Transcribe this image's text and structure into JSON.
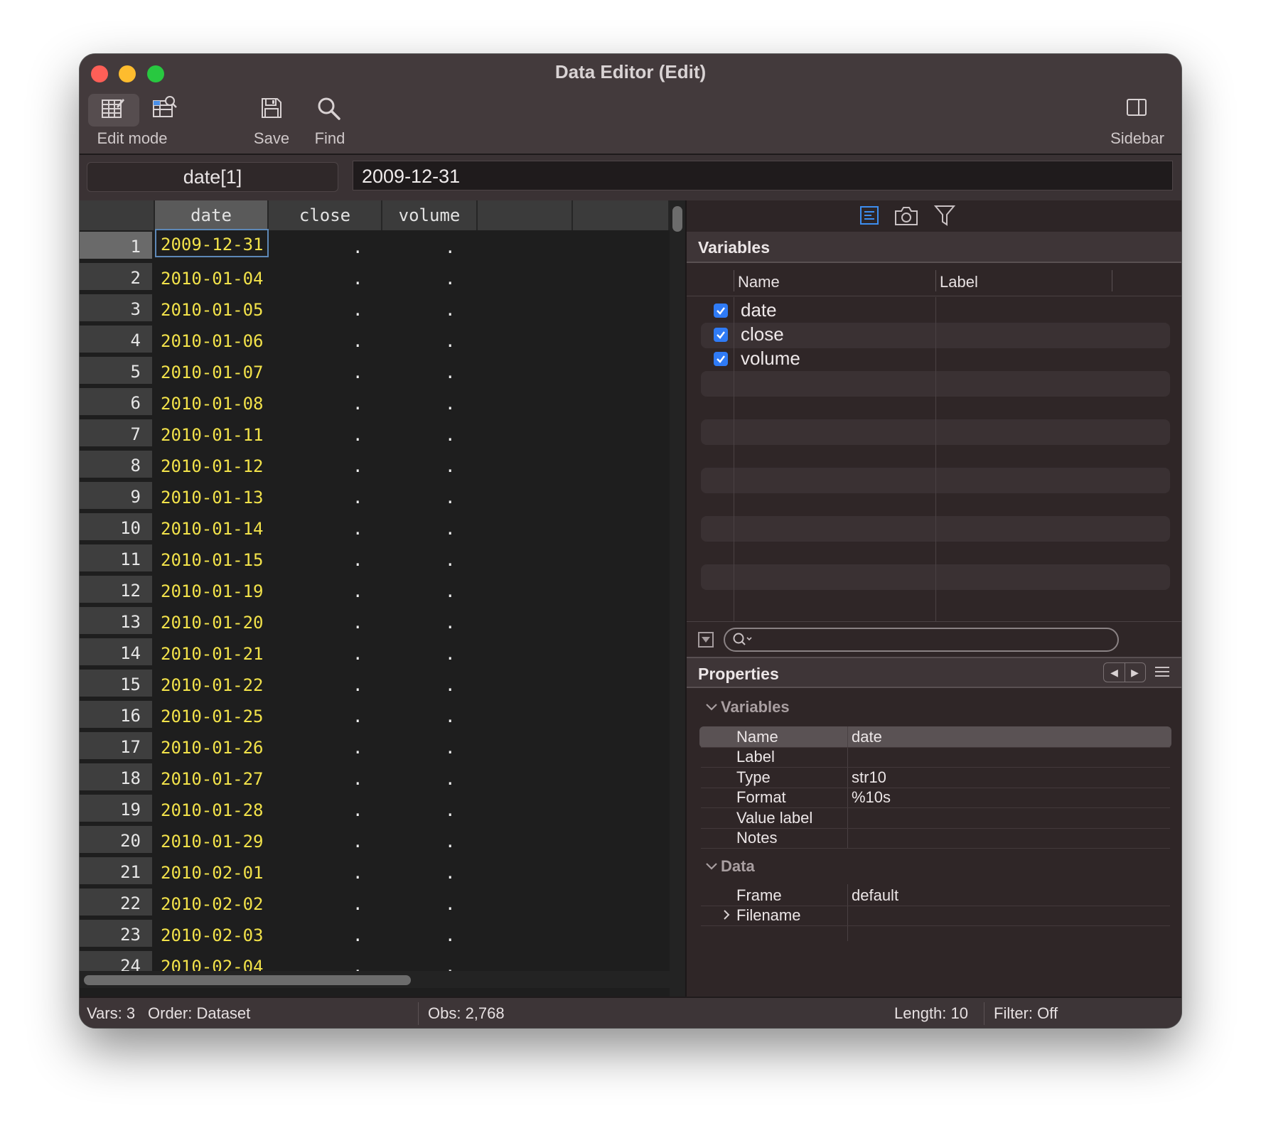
{
  "window": {
    "title": "Data Editor (Edit)"
  },
  "toolbar": {
    "edit_mode_label": "Edit mode",
    "save_label": "Save",
    "find_label": "Find",
    "sidebar_label": "Sidebar",
    "icons": [
      "edit-mode-icon",
      "browse-mode-icon",
      "save-icon",
      "find-icon",
      "sidebar-icon"
    ]
  },
  "cell": {
    "name": "date[1]",
    "value": "2009-12-31"
  },
  "grid": {
    "columns": [
      "date",
      "close",
      "volume"
    ],
    "rows": [
      {
        "n": "1",
        "date": "2009-12-31",
        "close": ".",
        "volume": "."
      },
      {
        "n": "2",
        "date": "2010-01-04",
        "close": ".",
        "volume": "."
      },
      {
        "n": "3",
        "date": "2010-01-05",
        "close": ".",
        "volume": "."
      },
      {
        "n": "4",
        "date": "2010-01-06",
        "close": ".",
        "volume": "."
      },
      {
        "n": "5",
        "date": "2010-01-07",
        "close": ".",
        "volume": "."
      },
      {
        "n": "6",
        "date": "2010-01-08",
        "close": ".",
        "volume": "."
      },
      {
        "n": "7",
        "date": "2010-01-11",
        "close": ".",
        "volume": "."
      },
      {
        "n": "8",
        "date": "2010-01-12",
        "close": ".",
        "volume": "."
      },
      {
        "n": "9",
        "date": "2010-01-13",
        "close": ".",
        "volume": "."
      },
      {
        "n": "10",
        "date": "2010-01-14",
        "close": ".",
        "volume": "."
      },
      {
        "n": "11",
        "date": "2010-01-15",
        "close": ".",
        "volume": "."
      },
      {
        "n": "12",
        "date": "2010-01-19",
        "close": ".",
        "volume": "."
      },
      {
        "n": "13",
        "date": "2010-01-20",
        "close": ".",
        "volume": "."
      },
      {
        "n": "14",
        "date": "2010-01-21",
        "close": ".",
        "volume": "."
      },
      {
        "n": "15",
        "date": "2010-01-22",
        "close": ".",
        "volume": "."
      },
      {
        "n": "16",
        "date": "2010-01-25",
        "close": ".",
        "volume": "."
      },
      {
        "n": "17",
        "date": "2010-01-26",
        "close": ".",
        "volume": "."
      },
      {
        "n": "18",
        "date": "2010-01-27",
        "close": ".",
        "volume": "."
      },
      {
        "n": "19",
        "date": "2010-01-28",
        "close": ".",
        "volume": "."
      },
      {
        "n": "20",
        "date": "2010-01-29",
        "close": ".",
        "volume": "."
      },
      {
        "n": "21",
        "date": "2010-02-01",
        "close": ".",
        "volume": "."
      },
      {
        "n": "22",
        "date": "2010-02-02",
        "close": ".",
        "volume": "."
      },
      {
        "n": "23",
        "date": "2010-02-03",
        "close": ".",
        "volume": "."
      },
      {
        "n": "24",
        "date": "2010-02-04",
        "close": ".",
        "volume": "."
      }
    ]
  },
  "variables_panel": {
    "title": "Variables",
    "col_name": "Name",
    "col_label": "Label",
    "items": [
      {
        "name": "date",
        "checked": true
      },
      {
        "name": "close",
        "checked": true
      },
      {
        "name": "volume",
        "checked": true
      }
    ],
    "search_placeholder": ""
  },
  "properties_panel": {
    "title": "Properties",
    "variables_group": "Variables",
    "variable_props": [
      {
        "label": "Name",
        "value": "date"
      },
      {
        "label": "Label",
        "value": ""
      },
      {
        "label": "Type",
        "value": "str10"
      },
      {
        "label": "Format",
        "value": "%10s"
      },
      {
        "label": "Value label",
        "value": ""
      },
      {
        "label": "Notes",
        "value": ""
      }
    ],
    "data_group": "Data",
    "data_props": [
      {
        "label": "Frame",
        "value": "default"
      },
      {
        "label": "Filename",
        "value": ""
      }
    ]
  },
  "status": {
    "vars": "Vars: 3",
    "order": "Order: Dataset",
    "obs": "Obs: 2,768",
    "length": "Length: 10",
    "filter": "Filter: Off"
  },
  "colors": {
    "date_text": "#f2e24a",
    "accent_blue": "#2f7bf6",
    "window_bg": "#3a3234",
    "grid_bg": "#1e1e1e"
  }
}
